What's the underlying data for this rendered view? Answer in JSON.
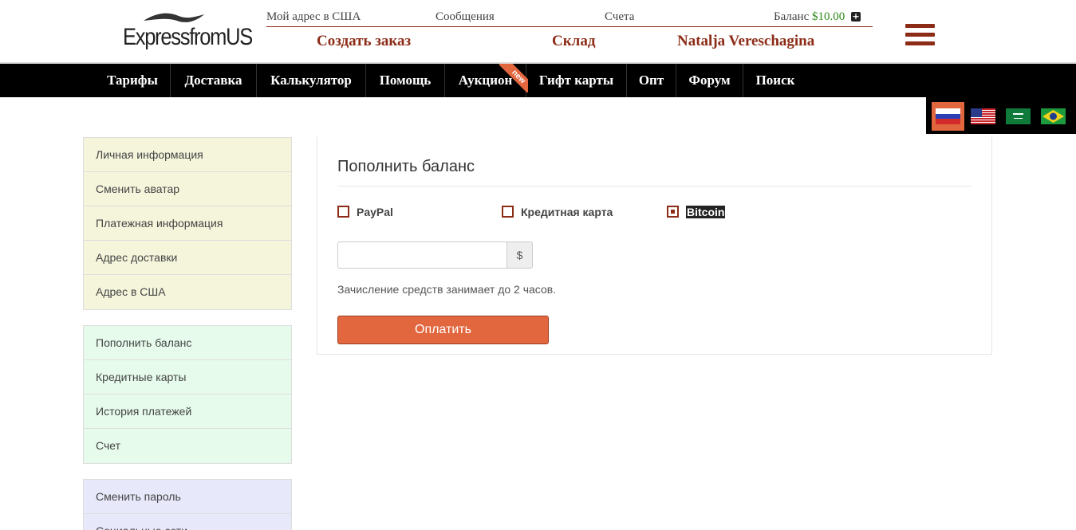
{
  "header": {
    "logo_text": "ExpressfromUS",
    "top_links": {
      "my_address": "Мой адрес в США",
      "messages": "Сообщения",
      "invoices": "Счета",
      "balance_label": "Баланс",
      "balance_value": "$10.00"
    },
    "create_order": "Создать заказ",
    "warehouse": "Склад",
    "user_name": "Natalja Vereschagina"
  },
  "nav": {
    "items": [
      "Тарифы",
      "Доставка",
      "Калькулятор",
      "Помощь",
      "Аукцион",
      "Гифт карты",
      "Опт",
      "Форум",
      "Поиск"
    ],
    "new_badge": "new"
  },
  "languages": [
    "ru",
    "us",
    "sa",
    "br"
  ],
  "sidebar": {
    "group1": [
      "Личная информация",
      "Сменить аватар",
      "Платежная информация",
      "Адрес доставки",
      "Адрес в США"
    ],
    "group2": [
      "Пополнить баланс",
      "Кредитные карты",
      "История платежей",
      "Счет"
    ],
    "group3": [
      "Сменить пароль",
      "Социальные сети"
    ]
  },
  "main": {
    "title": "Пополнить баланс",
    "payment_methods": [
      {
        "label": "PayPal",
        "selected": false
      },
      {
        "label": "Кредитная карта",
        "selected": false
      },
      {
        "label": "Bitcoin",
        "selected": true
      }
    ],
    "amount_value": "",
    "currency_symbol": "$",
    "note": "Зачисление средств занимает до 2 часов.",
    "pay_button": "Оплатить"
  },
  "colors": {
    "brand": "#8c2c17",
    "accent": "#e2673f",
    "balance": "#2b8a16",
    "nav_bg": "#000000"
  }
}
